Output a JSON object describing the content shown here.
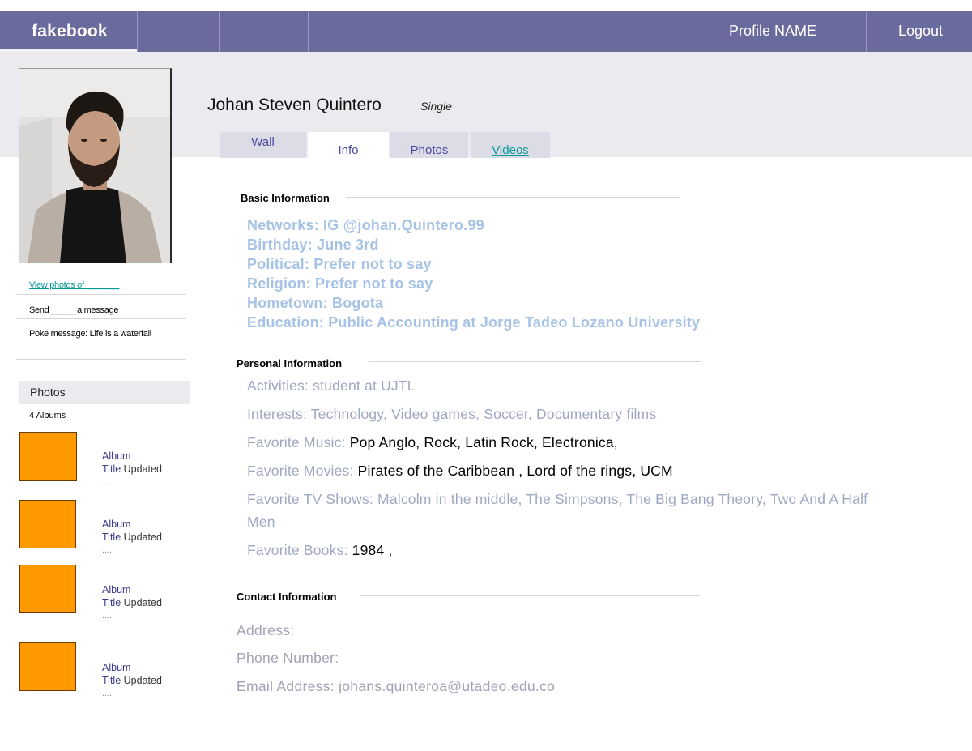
{
  "nav": {
    "logo": "fakebook",
    "profile_link": "Profile NAME",
    "logout_link": "Logout"
  },
  "sidebar": {
    "view_photos": "View photos of _______",
    "send_message": "Send _____ a message",
    "poke_message": "Poke message:  Life is a waterfall",
    "photos_heading": "Photos",
    "albums_count": "4 Albums",
    "albums": [
      {
        "line1": "Album",
        "line2_a": "Title",
        "line2_b": "Updated",
        "line3": "...."
      },
      {
        "line1": "Album",
        "line2_a": "Title",
        "line2_b": "Updated",
        "line3": "...."
      },
      {
        "line1": "Album",
        "line2_a": "Title",
        "line2_b": "Updated",
        "line3": "...."
      },
      {
        "line1": "Album",
        "line2_a": "Title",
        "line2_b": "Updated",
        "line3": "...."
      }
    ]
  },
  "profile": {
    "name": "Johan Steven Quintero",
    "status": "Single"
  },
  "tabs": [
    "Wall",
    "Info",
    "Photos",
    "Videos"
  ],
  "basic_info": {
    "title": "Basic Information",
    "lines": [
      "Networks: IG @johan.Quintero.99",
      "Birthday:  June 3rd",
      "Political: Prefer not to say",
      "Religion: Prefer not to say",
      "Hometown: Bogota",
      "Education: Public Accounting at Jorge Tadeo Lozano University"
    ]
  },
  "personal_info": {
    "title": "Personal Information",
    "activities": "Activities: student at UJTL",
    "interests": "Interests: Technology, Video games, Soccer, Documentary films",
    "music_label": "Favorite Music: ",
    "music_value": "Pop Anglo, Rock, Latin Rock, Electronica,",
    "movies_label": "Favorite Movies: ",
    "movies_value": "Pirates of the Caribbean , Lord of the rings, UCM",
    "tv": "Favorite TV Shows: Malcolm in the middle, The Simpsons, The Big Bang Theory, Two And A Half Men",
    "books_label": "Favorite Books: ",
    "books_value": "1984 ,"
  },
  "contact_info": {
    "title": "Contact Information",
    "address": "Address:",
    "phone": "Phone Number:",
    "email": "Email Address: johans.quinteroa@utadeo.edu.co"
  },
  "colors": {
    "nav_bg": "#6a6a9c",
    "band_bg": "#ebebef",
    "album_thumb": "#ff9900",
    "basic_text": "#a6c3e6",
    "link_teal": "#0a9a9a",
    "tab_text": "#4a4aa0"
  }
}
